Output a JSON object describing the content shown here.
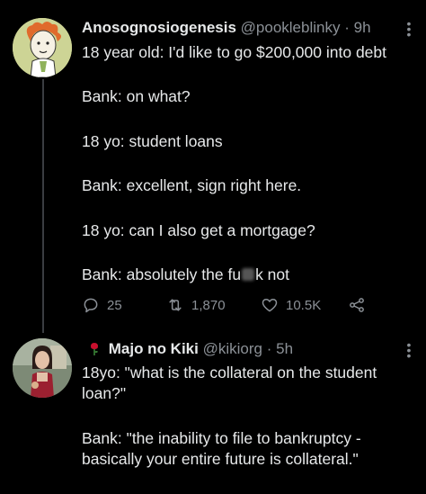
{
  "tweet1": {
    "display_name": "Anosognosiogenesis",
    "handle": "@pookleblinky",
    "separator": "·",
    "time": "9h",
    "lines": [
      "18 year old: I'd like to go $200,000 into debt",
      "Bank: on what?",
      "18 yo: student loans",
      "Bank: excellent, sign right here.",
      "18 yo: can I also get a mortgage?"
    ],
    "last_line_before": "Bank: absolutely the fu",
    "last_line_after": "k not",
    "replies": "25",
    "retweets": "1,870",
    "likes": "10.5K"
  },
  "tweet2": {
    "display_name": "Majo no Kiki",
    "handle": "@kikiorg",
    "separator": "·",
    "time": "5h",
    "lines": [
      "18yo: \"what is the collateral on the student",
      "loan?\"",
      "Bank: \"the inability to file to bankruptcy -",
      "basically your entire future is collateral.\""
    ]
  },
  "icons": {
    "reply": "reply-icon",
    "retweet": "retweet-icon",
    "like": "heart-icon",
    "share": "share-icon",
    "more": "more-options-icon",
    "name_emoji": "rose-icon"
  },
  "colors": {
    "background": "#000000",
    "text": "#e7e9ea",
    "muted": "#8b9096",
    "rose": "#c8102e"
  }
}
